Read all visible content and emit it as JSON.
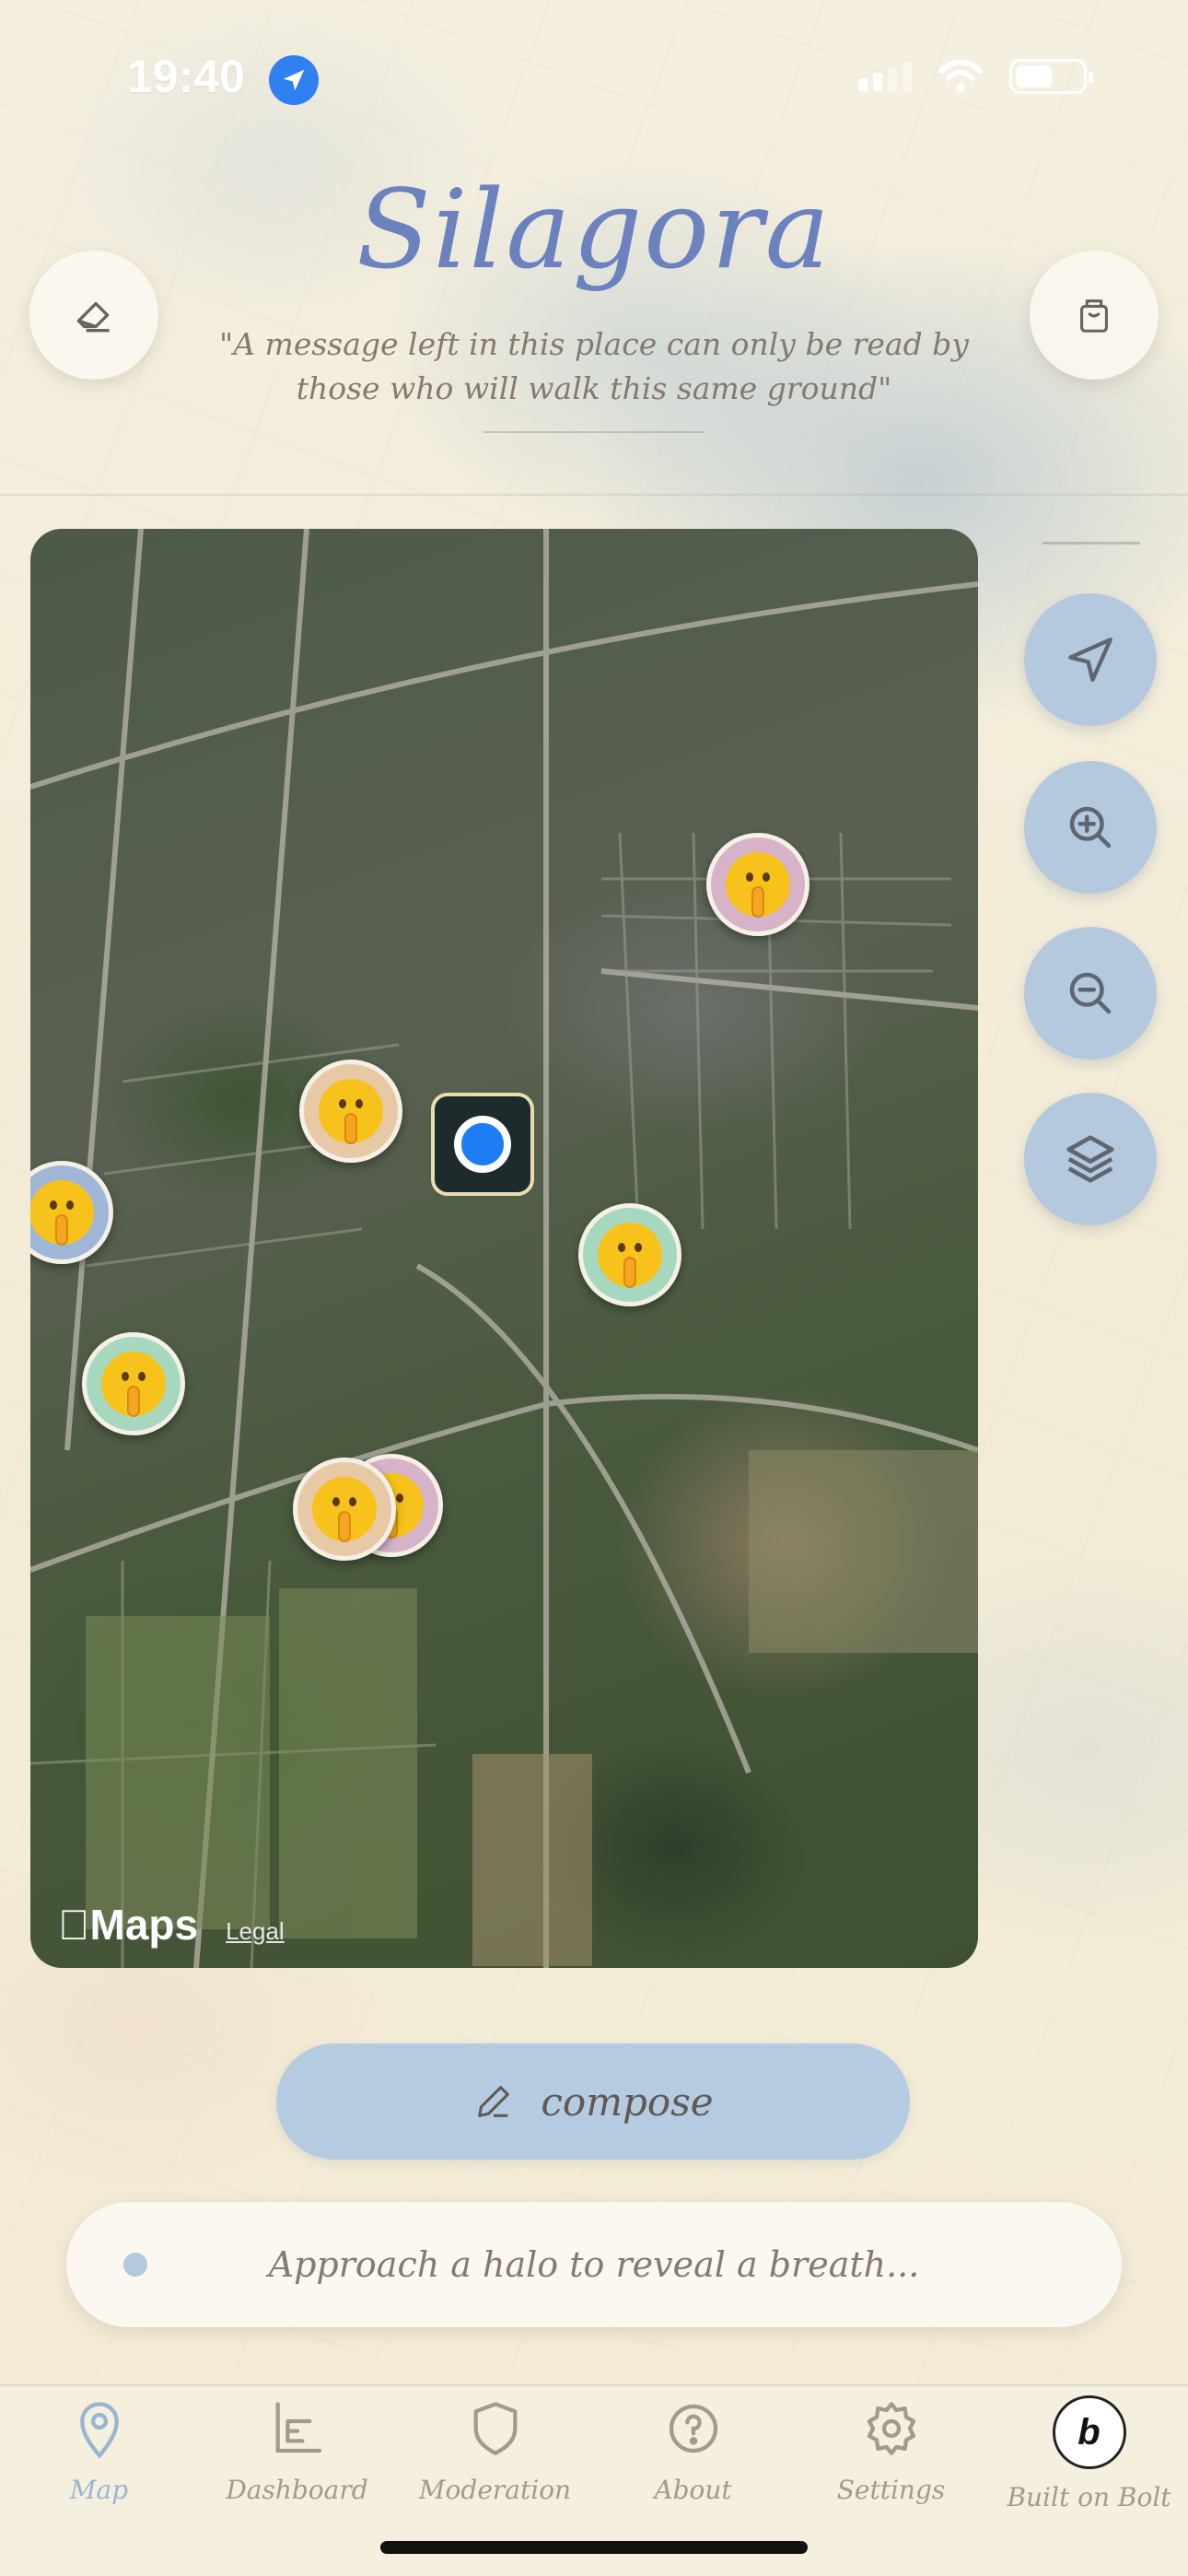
{
  "status": {
    "time": "19:40"
  },
  "header": {
    "title": "Silagora",
    "tagline": "\"A message left in this place can only be read by those who will walk this same ground\""
  },
  "map": {
    "brand": "Maps",
    "legal": "Legal"
  },
  "compose": {
    "label": "compose"
  },
  "reveal": {
    "placeholder": "Approach a halo to reveal a breath..."
  },
  "tabs": [
    {
      "label": "Map",
      "icon": "map-pin-icon",
      "active": true
    },
    {
      "label": "Dashboard",
      "icon": "chart-icon"
    },
    {
      "label": "Moderation",
      "icon": "shield-icon"
    },
    {
      "label": "About",
      "icon": "question-icon"
    },
    {
      "label": "Settings",
      "icon": "gear-icon"
    },
    {
      "label": "Built on Bolt",
      "icon": "bolt-badge-icon"
    }
  ],
  "colors": {
    "accent_title": "#6b82bf",
    "control_blue": "#b4c9de",
    "pin_pink": "#d6b3c9",
    "pin_peach": "#e8c9a6",
    "pin_blue": "#9fb6d6",
    "pin_mint": "#a6d8c0"
  }
}
